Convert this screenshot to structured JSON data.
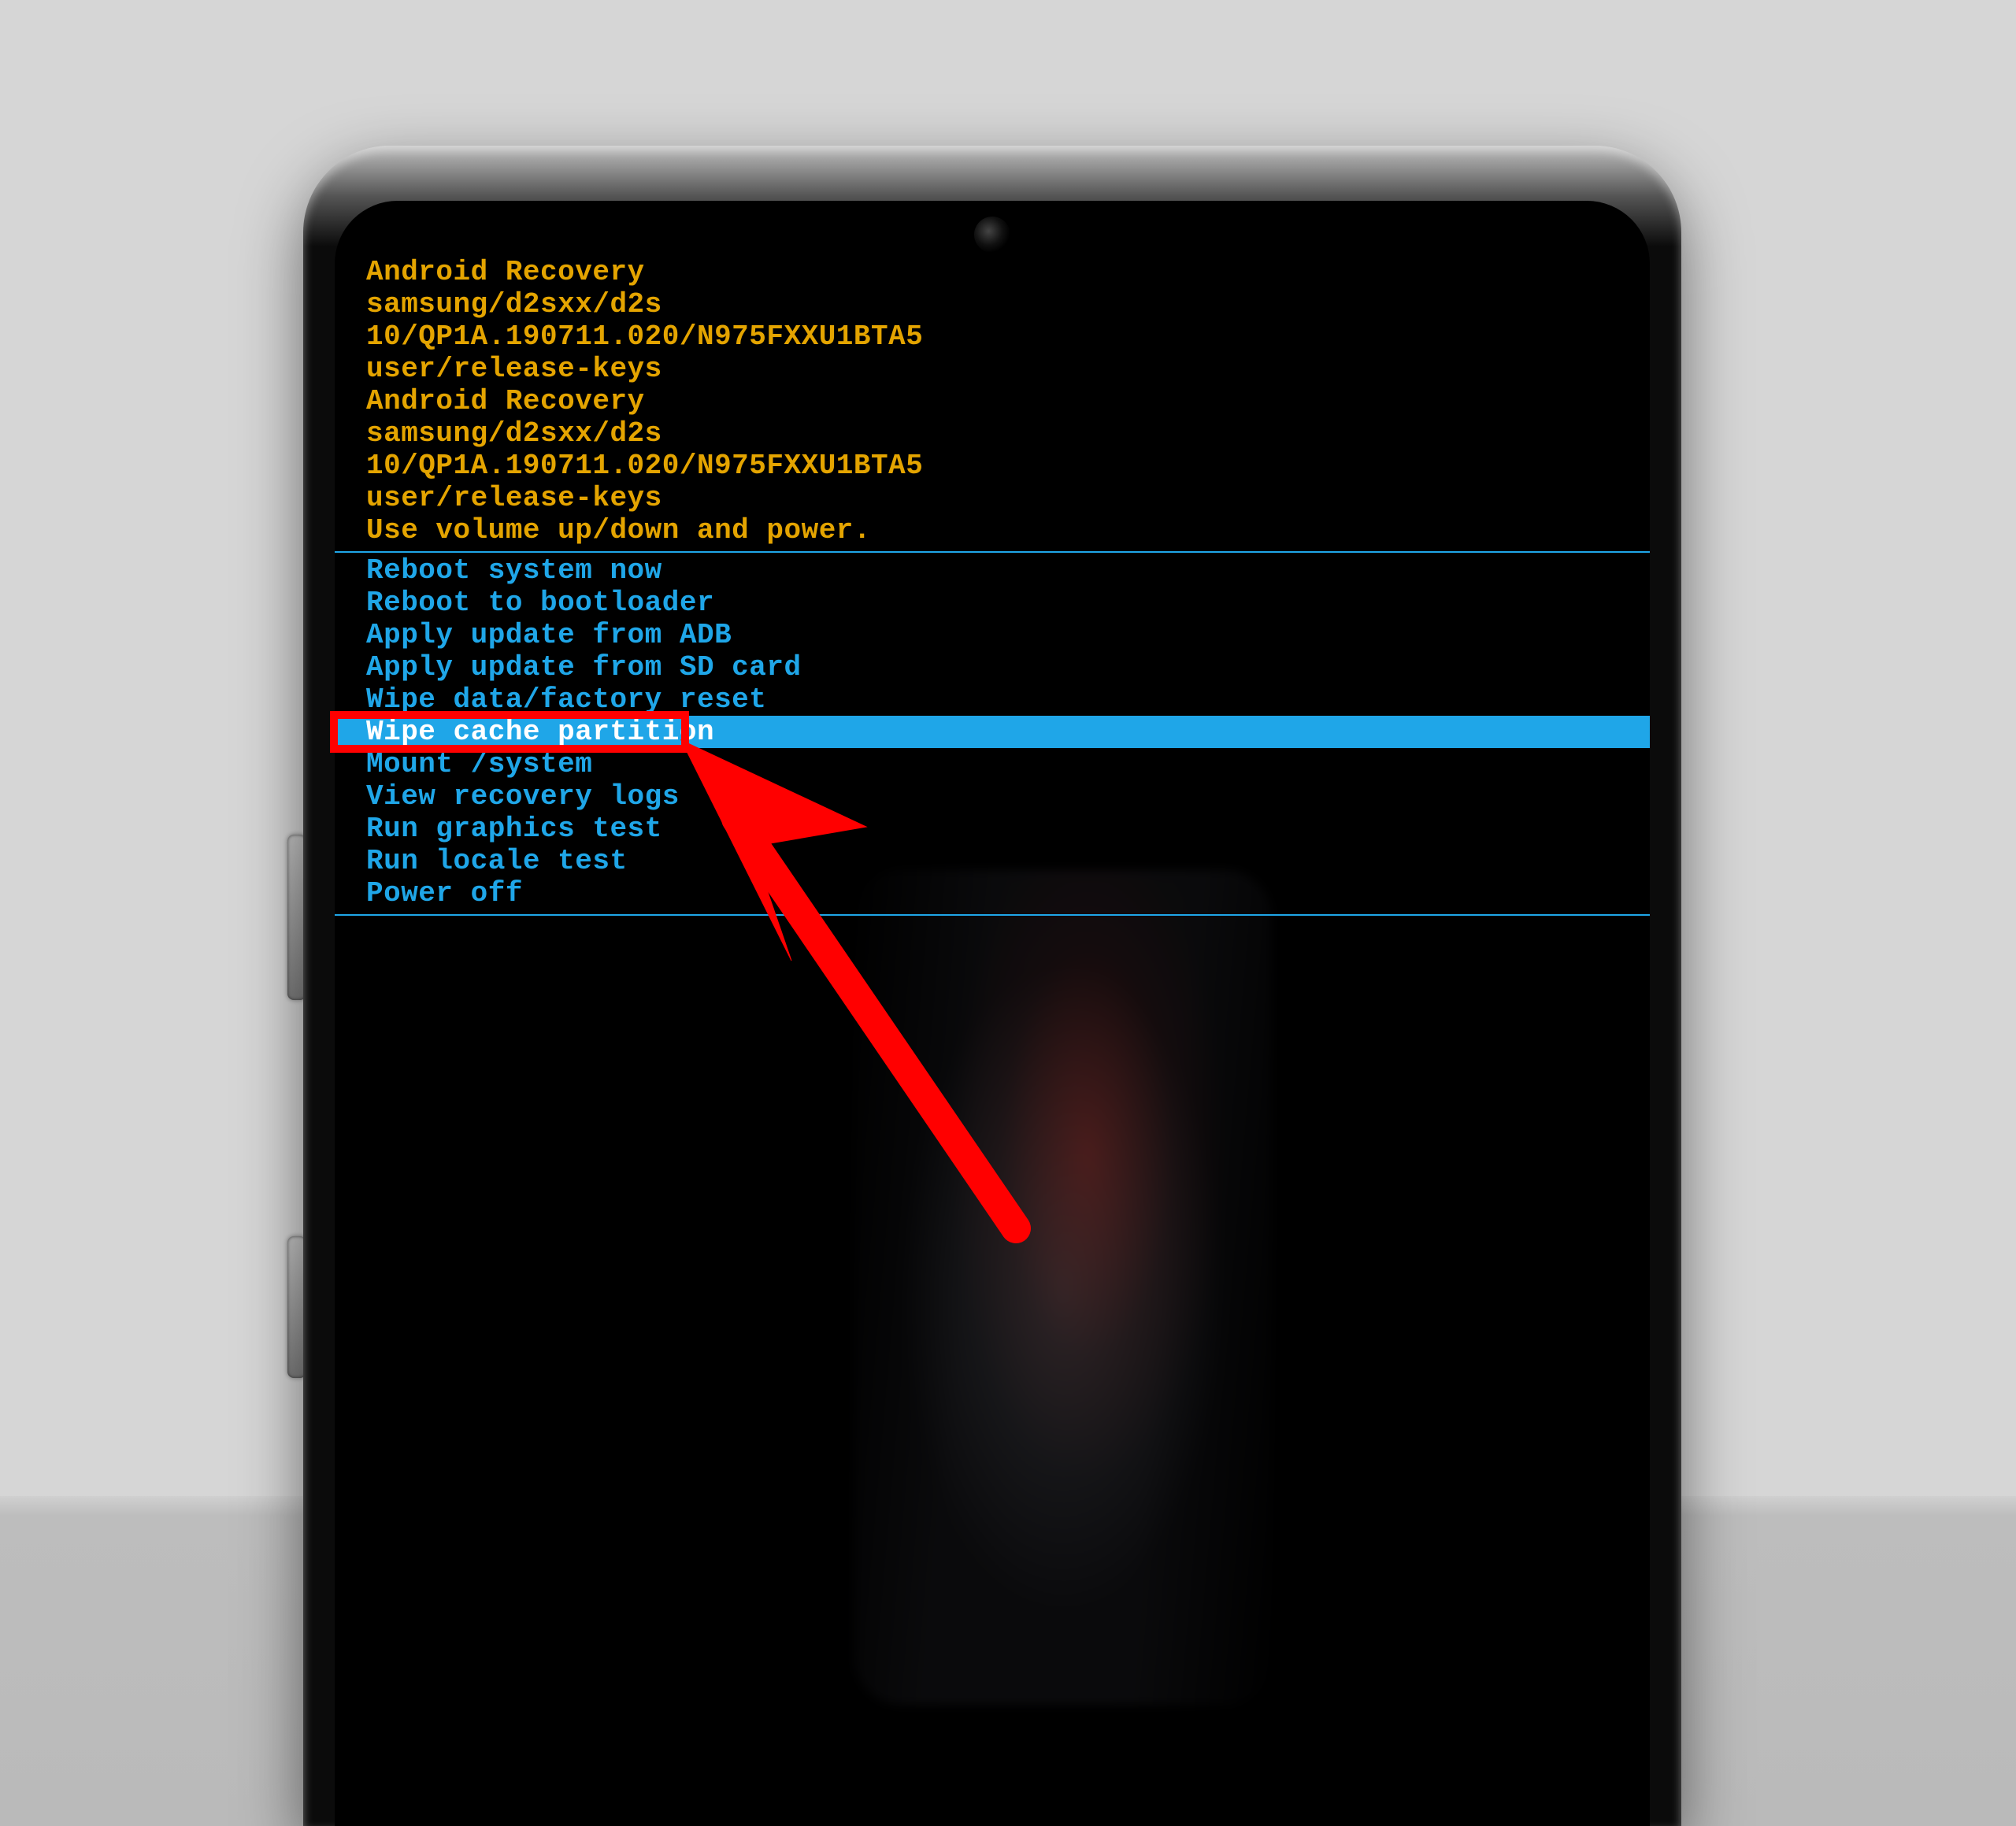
{
  "header": {
    "title1": "Android Recovery",
    "line1a": "samsung/d2sxx/d2s",
    "line1b": "10/QP1A.190711.020/N975FXXU1BTA5",
    "line1c": "user/release-keys",
    "title2": "Android Recovery",
    "line2a": "samsung/d2sxx/d2s",
    "line2b": "10/QP1A.190711.020/N975FXXU1BTA5",
    "line2c": "user/release-keys",
    "hint": "Use volume up/down and power."
  },
  "menu": {
    "selected_index": 5,
    "items": [
      "Reboot system now",
      "Reboot to bootloader",
      "Apply update from ADB",
      "Apply update from SD card",
      "Wipe data/factory reset",
      "Wipe cache partition",
      "Mount /system",
      "View recovery logs",
      "Run graphics test",
      "Run locale test",
      "Power off"
    ]
  },
  "annotation": {
    "highlight_target": "Wipe cache partition"
  },
  "colors": {
    "header_text": "#e4a400",
    "menu_text": "#1fa6e8",
    "selected_bg": "#1fa6e8",
    "selected_fg": "#ffffff",
    "annotation": "#ff0000"
  }
}
